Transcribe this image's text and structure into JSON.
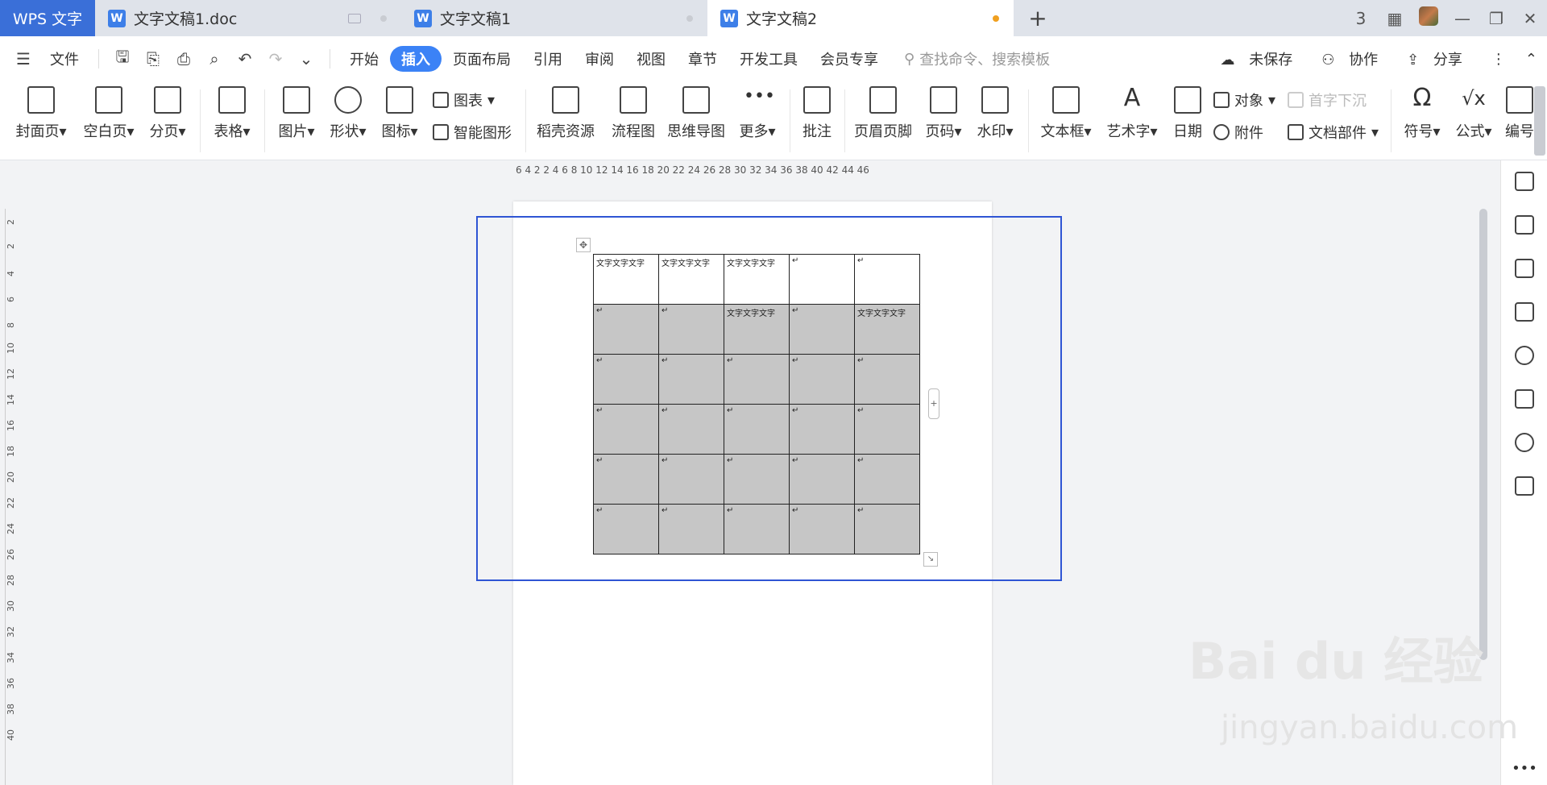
{
  "titlebar": {
    "app": "WPS 文字",
    "tabs": [
      "文字文稿1.doc",
      "文字文稿1",
      "文字文稿2"
    ],
    "new_tab": "+",
    "cloud_label": "3"
  },
  "menu": {
    "file": "文件",
    "items": [
      "开始",
      "插入",
      "页面布局",
      "引用",
      "审阅",
      "视图",
      "章节",
      "开发工具",
      "会员专享"
    ],
    "search": "查找命令、搜索模板",
    "unsaved": "未保存",
    "collab": "协作",
    "share": "分享"
  },
  "ribbon": {
    "cover": "封面页",
    "blank": "空白页",
    "pagebreak": "分页",
    "table": "表格",
    "picture": "图片",
    "shape": "形状",
    "icon": "图标",
    "chart": "图表",
    "smartart": "智能图形",
    "daoke": "稻壳资源",
    "flow": "流程图",
    "mindmap": "思维导图",
    "more": "更多",
    "comment": "批注",
    "header": "页眉页脚",
    "pagenum": "页码",
    "watermark": "水印",
    "textbox": "文本框",
    "wordart": "艺术字",
    "date": "日期",
    "object": "对象",
    "dropcap": "首字下沉",
    "attach": "附件",
    "docpart": "文档部件",
    "symbol": "符号",
    "formula": "公式",
    "edit": "编号"
  },
  "ruler": {
    "h_ticks": "6  4  2    2  4  6  8 10 12 14 16 18 20 22 24 26 28 30 32 34 36 38 40 42 44 46",
    "v_ticks": [
      "2",
      "2",
      "4",
      "6",
      "8",
      "10",
      "12",
      "14",
      "16",
      "18",
      "20",
      "22",
      "24",
      "26",
      "28",
      "30",
      "32",
      "34",
      "36",
      "38",
      "40"
    ]
  },
  "table": {
    "rows": [
      [
        "文字文字文字",
        "文字文字文字",
        "文字文字文字",
        "↵",
        "↵"
      ],
      [
        "↵",
        "↵",
        "文字文字文字",
        "↵",
        "文字文字文字"
      ],
      [
        "↵",
        "↵",
        "↵",
        "↵",
        "↵"
      ],
      [
        "↵",
        "↵",
        "↵",
        "↵",
        "↵"
      ],
      [
        "↵",
        "↵",
        "↵",
        "↵",
        "↵"
      ],
      [
        "↵",
        "↵",
        "↵",
        "↵",
        "↵"
      ]
    ]
  },
  "watermark": {
    "main": "Bai du 经验",
    "sub": "jingyan.baidu.com"
  },
  "side_more": "•••"
}
